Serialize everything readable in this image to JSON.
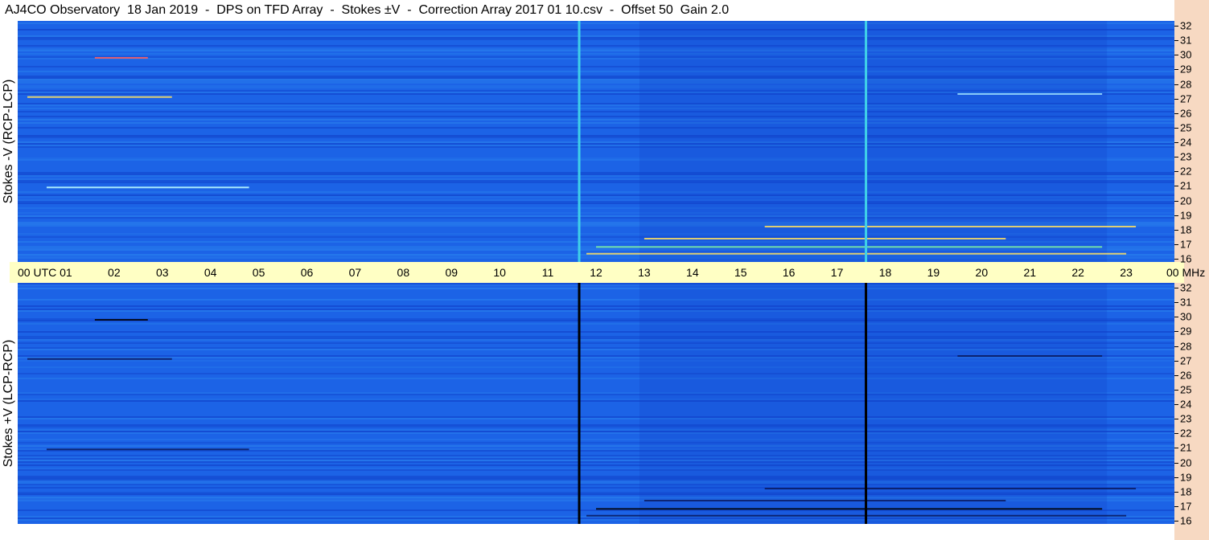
{
  "title": "AJ4CO Observatory  18 Jan 2019  -  DPS on TFD Array  -  Stokes ±V  -  Correction Array 2017 01 10.csv  -  Offset 50  Gain 2.0",
  "panels": [
    {
      "id": "top",
      "ylabel": "Stokes -V (RCP-LCP)"
    },
    {
      "id": "bottom",
      "ylabel": "Stokes +V (LCP-RCP)"
    }
  ],
  "chart_data": {
    "type": "heatmap",
    "x_tick_labels": [
      "00 UTC",
      "01",
      "02",
      "03",
      "04",
      "05",
      "06",
      "07",
      "08",
      "09",
      "10",
      "11",
      "12",
      "13",
      "14",
      "15",
      "16",
      "17",
      "18",
      "19",
      "20",
      "21",
      "22",
      "23",
      "00 MHz"
    ],
    "x_range_hours": [
      0,
      24
    ],
    "y_unit": "MHz",
    "y_range": [
      16,
      32
    ],
    "y_tick_labels": [
      "32",
      "31",
      "30",
      "29",
      "28",
      "27",
      "26",
      "25",
      "24",
      "23",
      "22",
      "21",
      "20",
      "19",
      "18",
      "17",
      "16"
    ],
    "vertical_lines_utc": [
      11.65,
      17.6
    ],
    "colors": {
      "background": "#1c63e6",
      "deep": "#1040c8",
      "light": "#2f8cf0",
      "top_vline": "#3fd0e8",
      "bottom_vline": "#000000",
      "axis_band": "#ffffc4",
      "right_strip": "#f7d9c2"
    }
  }
}
